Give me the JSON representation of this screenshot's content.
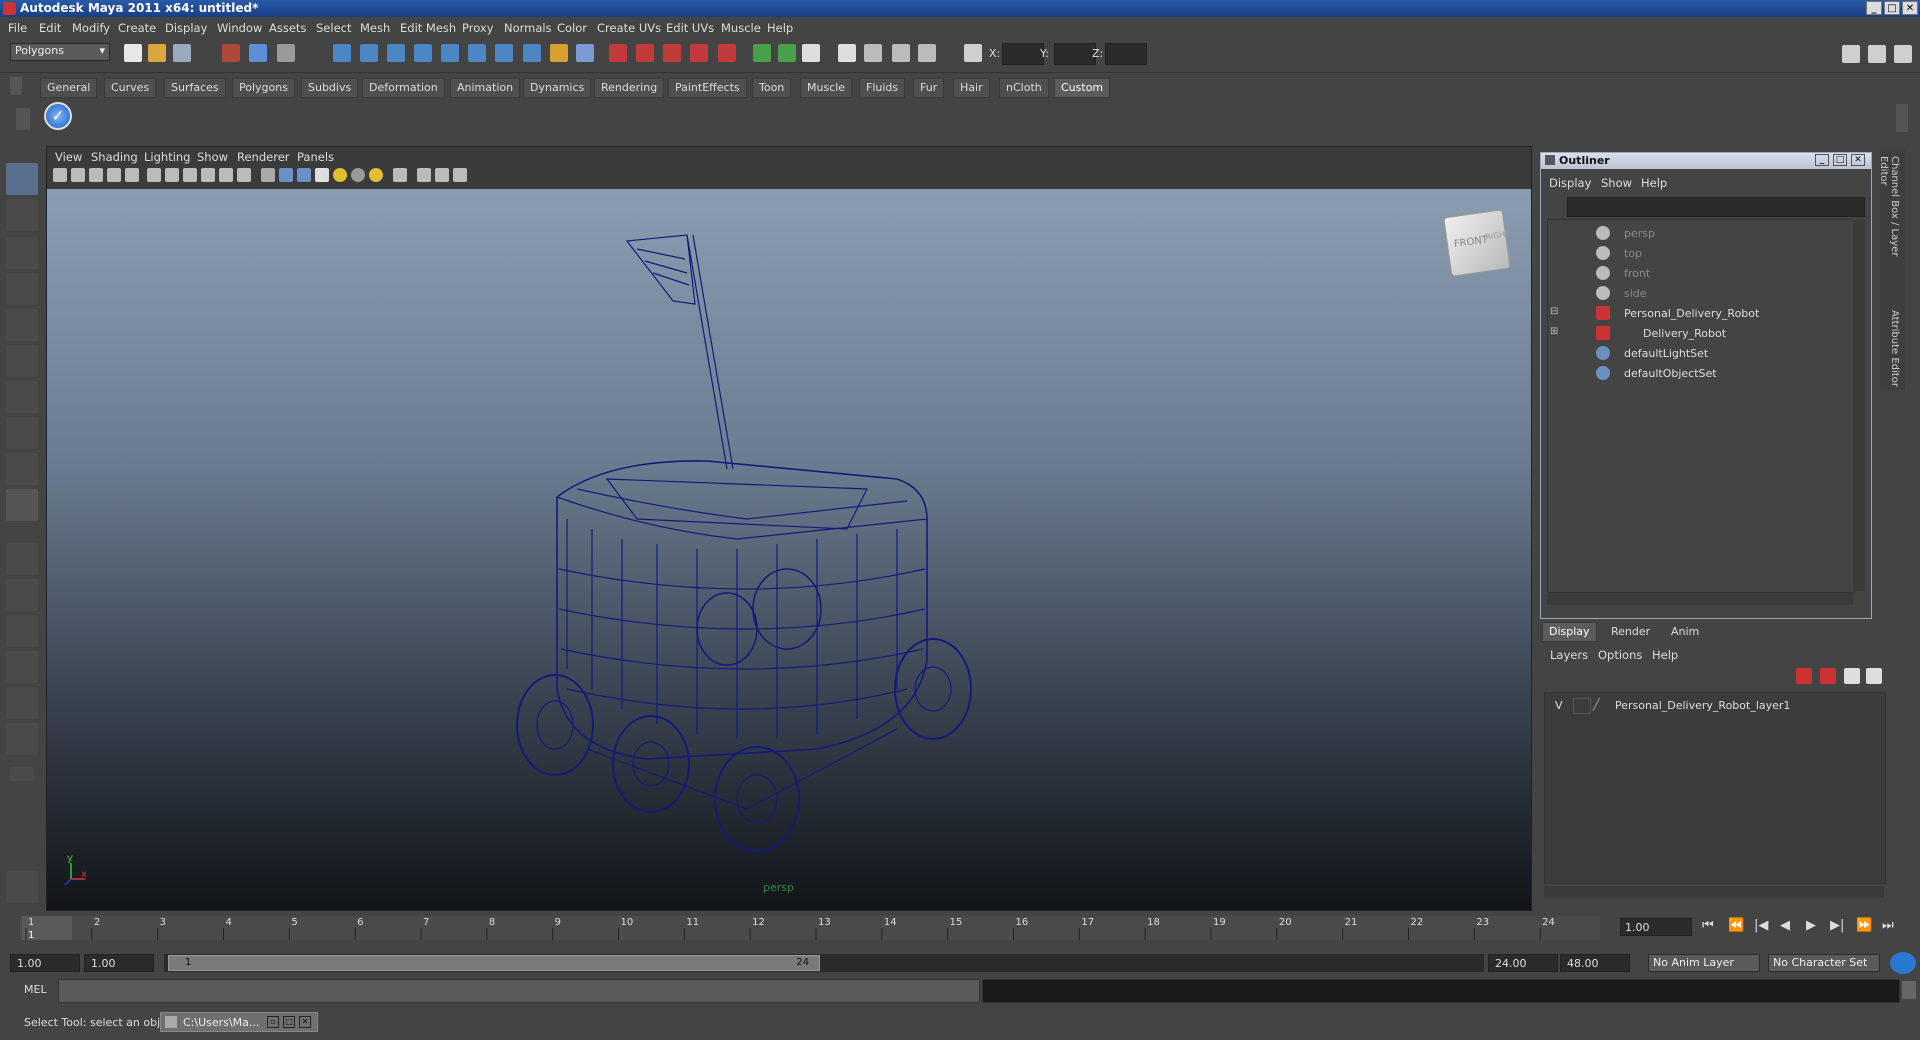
{
  "window": {
    "title": "Autodesk Maya 2011 x64: untitled*"
  },
  "menubar": [
    "File",
    "Edit",
    "Modify",
    "Create",
    "Display",
    "Window",
    "Assets",
    "Select",
    "Mesh",
    "Edit Mesh",
    "Proxy",
    "Normals",
    "Color",
    "Create UVs",
    "Edit UVs",
    "Muscle",
    "Help"
  ],
  "statusline": {
    "menuset": "Polygons",
    "x_label": "X:",
    "y_label": "Y:",
    "z_label": "Z:"
  },
  "shelf": {
    "tabs": [
      "General",
      "Curves",
      "Surfaces",
      "Polygons",
      "Subdivs",
      "Deformation",
      "Animation",
      "Dynamics",
      "Rendering",
      "PaintEffects",
      "Toon",
      "Muscle",
      "Fluids",
      "Fur",
      "Hair",
      "nCloth",
      "Custom"
    ],
    "active": "Custom"
  },
  "viewport": {
    "menus": [
      "View",
      "Shading",
      "Lighting",
      "Show",
      "Renderer",
      "Panels"
    ],
    "camera_label": "persp",
    "cube_front": "FRONT",
    "cube_right": "RIGHT",
    "axis_x": "x",
    "axis_y": "y"
  },
  "outliner": {
    "title": "Outliner",
    "menus": [
      "Display",
      "Show",
      "Help"
    ],
    "items": [
      {
        "label": "persp",
        "dim": true
      },
      {
        "label": "top",
        "dim": true
      },
      {
        "label": "front",
        "dim": true
      },
      {
        "label": "side",
        "dim": true
      },
      {
        "label": "Personal_Delivery_Robot",
        "dim": false
      },
      {
        "label": "Delivery_Robot",
        "dim": false
      },
      {
        "label": "defaultLightSet",
        "dim": false
      },
      {
        "label": "defaultObjectSet",
        "dim": false
      }
    ]
  },
  "layer_editor": {
    "tabs": [
      "Display",
      "Render",
      "Anim"
    ],
    "active_tab": "Display",
    "menus": [
      "Layers",
      "Options",
      "Help"
    ],
    "layer": {
      "visible": "V",
      "name": "Personal_Delivery_Robot_layer1"
    }
  },
  "side_tabs": [
    "Channel Box / Layer Editor",
    "Attribute Editor"
  ],
  "timeline": {
    "ticks": [
      "1",
      "2",
      "3",
      "4",
      "5",
      "6",
      "7",
      "8",
      "9",
      "10",
      "11",
      "12",
      "13",
      "14",
      "15",
      "16",
      "17",
      "18",
      "19",
      "20",
      "21",
      "22",
      "23",
      "24"
    ],
    "current_frame": "1.00",
    "cursor_frame": "1"
  },
  "range": {
    "start": "1.00",
    "playback_start": "1.00",
    "slider_start": "1",
    "slider_end": "24",
    "playback_end": "24.00",
    "end": "48.00",
    "anim_layer": "No Anim Layer",
    "character_set": "No Character Set"
  },
  "cmdline": {
    "label": "MEL"
  },
  "helpline": {
    "text": "Select Tool: select an object",
    "task": "C:\\Users\\Ma..."
  }
}
